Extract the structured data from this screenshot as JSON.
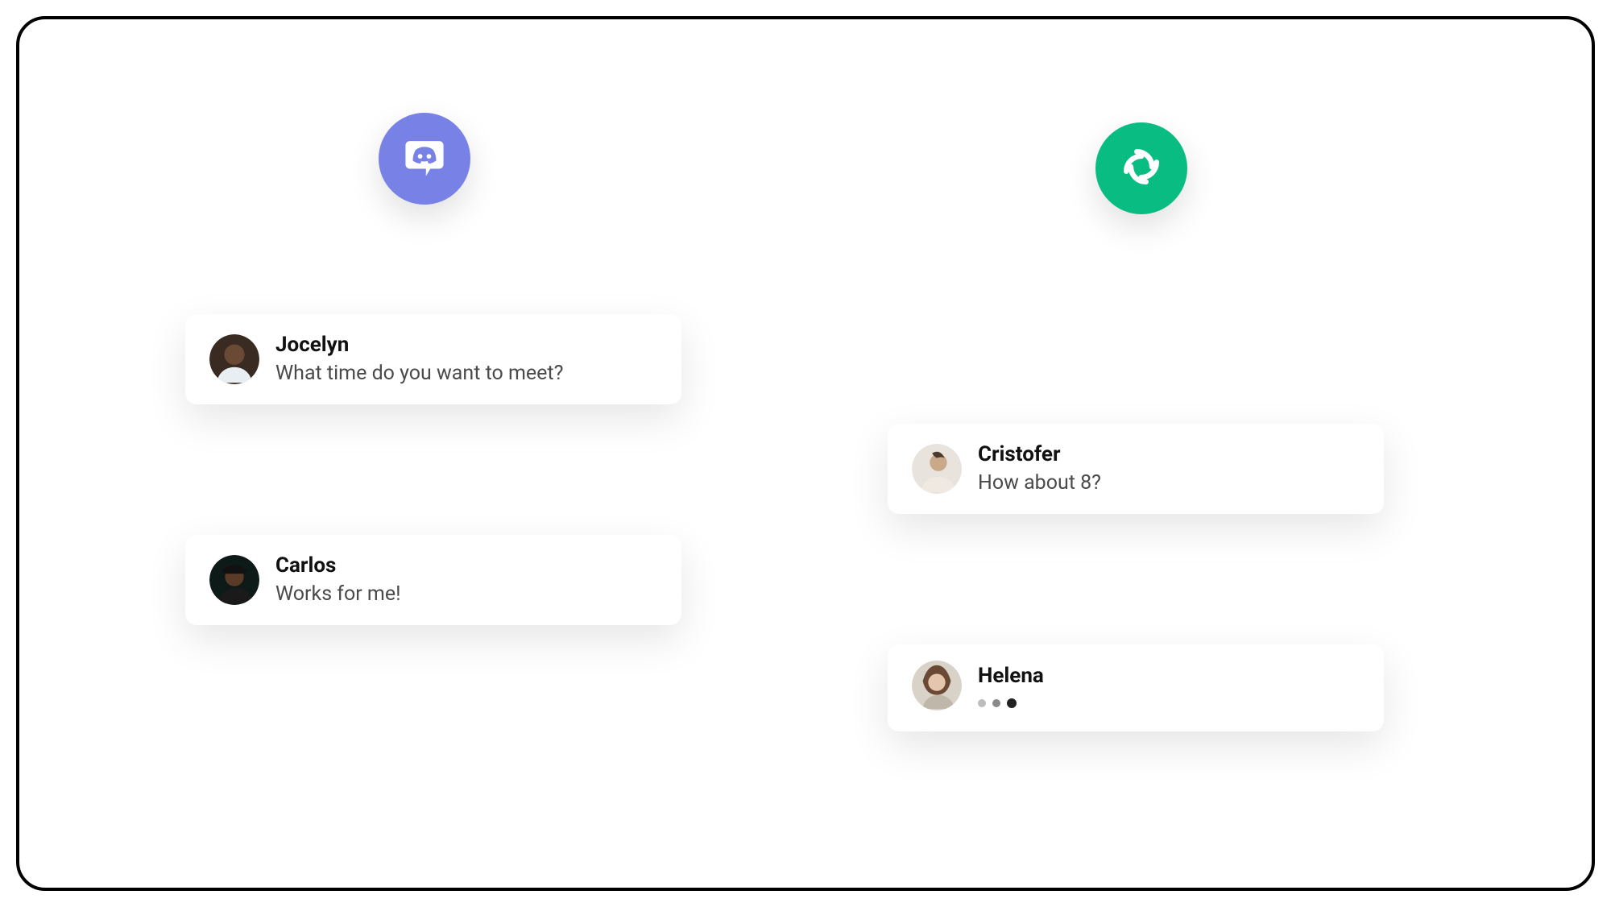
{
  "badges": {
    "discord": {
      "name": "discord",
      "color": "#7781e6"
    },
    "element": {
      "name": "element",
      "color": "#09bd82"
    }
  },
  "messages": {
    "jocelyn": {
      "name": "Jocelyn",
      "text": "What time do you want to meet?"
    },
    "cristofer": {
      "name": "Cristofer",
      "text": "How about 8?"
    },
    "carlos": {
      "name": "Carlos",
      "text": "Works for me!"
    },
    "helena": {
      "name": "Helena",
      "typing": true
    }
  }
}
